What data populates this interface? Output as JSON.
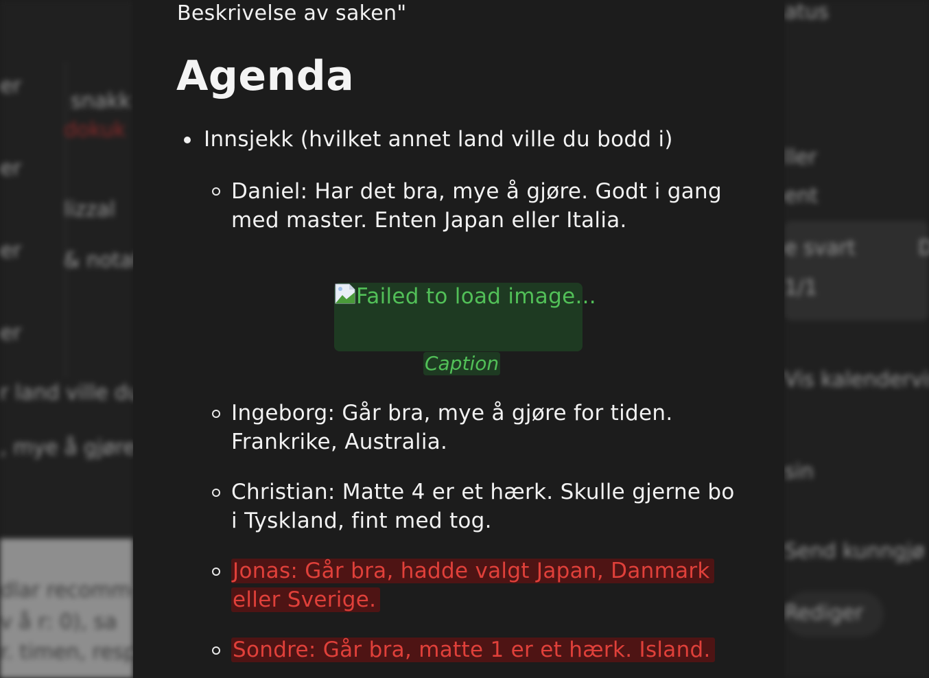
{
  "document": {
    "description_tail": "Beskrivelse av saken\"",
    "heading": "Agenda",
    "top_item": "Innsjekk (hvilket annet land ville du bodd i)",
    "sub_items": [
      {
        "text": "Daniel: Har det bra, mye å gjøre. Godt i gang med master. Enten Japan eller Italia.",
        "highlight": false
      },
      {
        "text": "Ingeborg: Går bra, mye å gjøre for tiden. Frankrike, Australia.",
        "highlight": false
      },
      {
        "text": "Christian: Matte 4 er et hærk. Skulle gjerne bo i Tyskland, fint med tog.",
        "highlight": false
      },
      {
        "text": "Jonas: Går bra, hadde valgt Japan, Danmark eller Sverige.",
        "highlight": true
      },
      {
        "text": "Sondre: Går bra, matte 1 er et hærk. Island.",
        "highlight": true
      }
    ],
    "image": {
      "alt": "Failed to load image...",
      "caption": "Caption",
      "icon": "broken-image-icon"
    }
  },
  "background_left": {
    "fragments": [
      "er",
      "snakk",
      "dokuk",
      "er",
      "lizzal",
      "er",
      "& notat",
      "er",
      "r land ville du",
      ", mye å gjøre",
      "dlar recomme",
      "v å r: 0), sa",
      "r. timen, resp"
    ]
  },
  "background_right": {
    "fragments": [
      "atus",
      "ller",
      "ent",
      "e svart",
      "D",
      "1/1",
      "Vis kalendervis",
      "sin",
      "Send kunngjø",
      "Rediger"
    ]
  },
  "colors": {
    "highlight_red_text": "#e0403a",
    "highlight_red_bg": "#4e1414",
    "green_text": "#52c058",
    "green_bg": "#1e3a22",
    "page_bg": "#1c1c1c"
  }
}
